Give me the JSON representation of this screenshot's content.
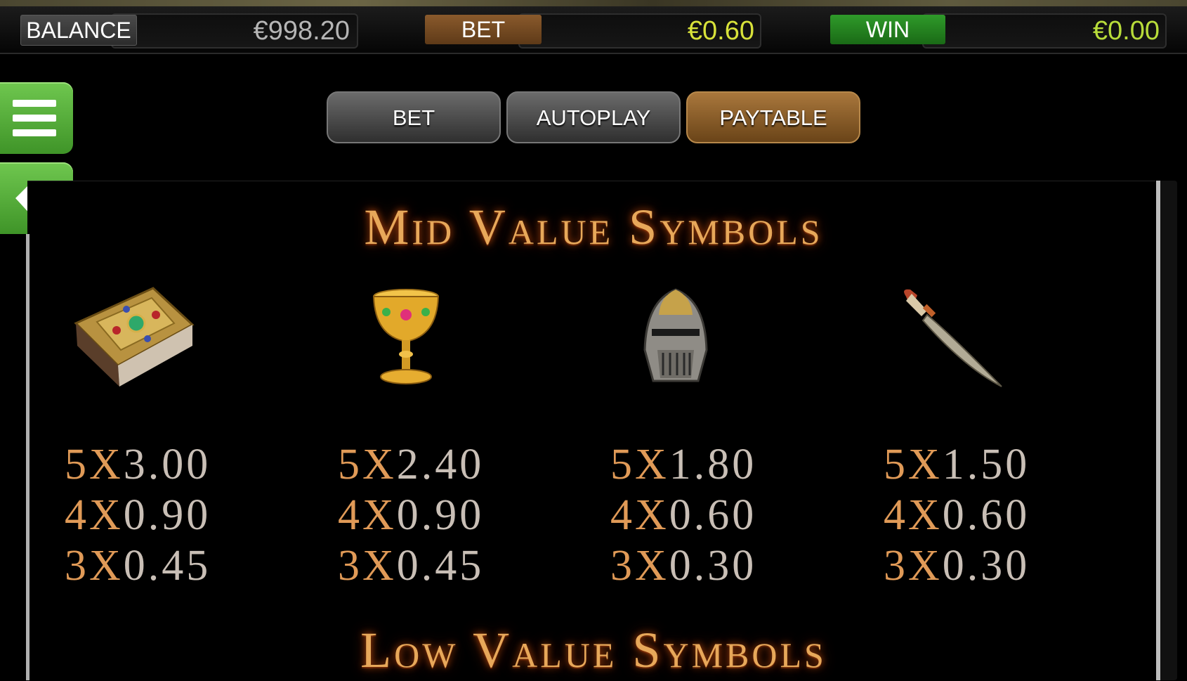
{
  "info_bar": {
    "balance_label": "BALANCE",
    "balance_value": "€998.20",
    "bet_label": "BET",
    "bet_value": "€0.60",
    "win_label": "WIN",
    "win_value": "€0.00"
  },
  "side_buttons": {
    "menu_icon": "hamburger-menu-icon",
    "back_icon": "arrow-left-icon"
  },
  "tabs": [
    {
      "label": "BET",
      "active": false
    },
    {
      "label": "AUTOPLAY",
      "active": false
    },
    {
      "label": "PAYTABLE",
      "active": true
    }
  ],
  "paytable": {
    "mid_title": "Mid Value Symbols",
    "low_title": "Low Value Symbols",
    "symbols": [
      {
        "icon": "jeweled-book-icon",
        "pays": [
          {
            "count": "5X",
            "value": "3.00"
          },
          {
            "count": "4X",
            "value": "0.90"
          },
          {
            "count": "3X",
            "value": "0.45"
          }
        ]
      },
      {
        "icon": "golden-chalice-icon",
        "pays": [
          {
            "count": "5X",
            "value": "2.40"
          },
          {
            "count": "4X",
            "value": "0.90"
          },
          {
            "count": "3X",
            "value": "0.45"
          }
        ]
      },
      {
        "icon": "knight-helmet-icon",
        "pays": [
          {
            "count": "5X",
            "value": "1.80"
          },
          {
            "count": "4X",
            "value": "0.60"
          },
          {
            "count": "3X",
            "value": "0.30"
          }
        ]
      },
      {
        "icon": "curved-dagger-icon",
        "pays": [
          {
            "count": "5X",
            "value": "1.50"
          },
          {
            "count": "4X",
            "value": "0.60"
          },
          {
            "count": "3X",
            "value": "0.30"
          }
        ]
      }
    ]
  },
  "colors": {
    "menu_green": "#4faa35",
    "active_tab": "#8d5f2c",
    "bet_value": "#d8e23a",
    "title_glow": "#e7a85a"
  }
}
